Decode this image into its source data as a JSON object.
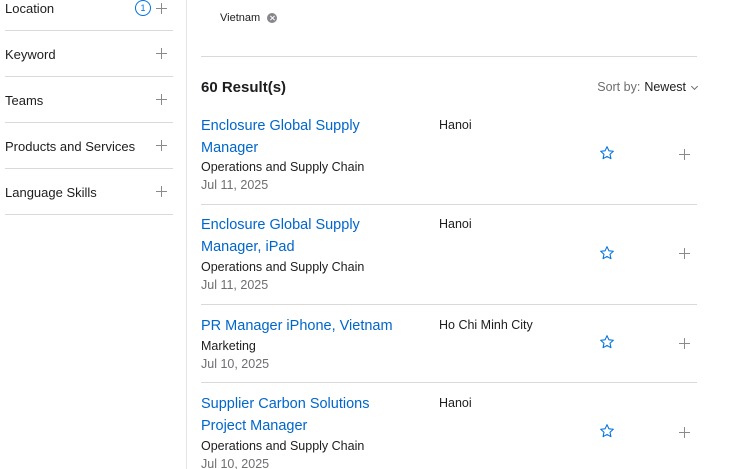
{
  "sidebar": {
    "filters": [
      {
        "label": "Location",
        "badge": "1"
      },
      {
        "label": "Keyword"
      },
      {
        "label": "Teams"
      },
      {
        "label": "Products and Services"
      },
      {
        "label": "Language Skills"
      }
    ]
  },
  "selected_filters": [
    {
      "label": "Vietnam"
    }
  ],
  "results": {
    "count_label": "60 Result(s)",
    "sort_label": "Sort by:",
    "sort_value": "Newest"
  },
  "jobs": [
    {
      "title": "Enclosure Global Supply Manager",
      "team": "Operations and Supply Chain",
      "date": "Jul 11, 2025",
      "location": "Hanoi"
    },
    {
      "title": "Enclosure Global Supply Manager, iPad",
      "team": "Operations and Supply Chain",
      "date": "Jul 11, 2025",
      "location": "Hanoi"
    },
    {
      "title": "PR Manager iPhone, Vietnam",
      "team": "Marketing",
      "date": "Jul 10, 2025",
      "location": "Ho Chi Minh City"
    },
    {
      "title": "Supplier Carbon Solutions Project Manager",
      "team": "Operations and Supply Chain",
      "date": "Jul 10, 2025",
      "location": "Hanoi"
    }
  ],
  "icons": {
    "star": "star-outline-icon",
    "plus": "plus-icon",
    "remove": "close-circle-icon",
    "chevron": "chevron-down-icon"
  },
  "colors": {
    "link": "#0066cc",
    "accent": "#0071e3",
    "divider": "#d9d9d9",
    "muted": "#6e6e73"
  }
}
